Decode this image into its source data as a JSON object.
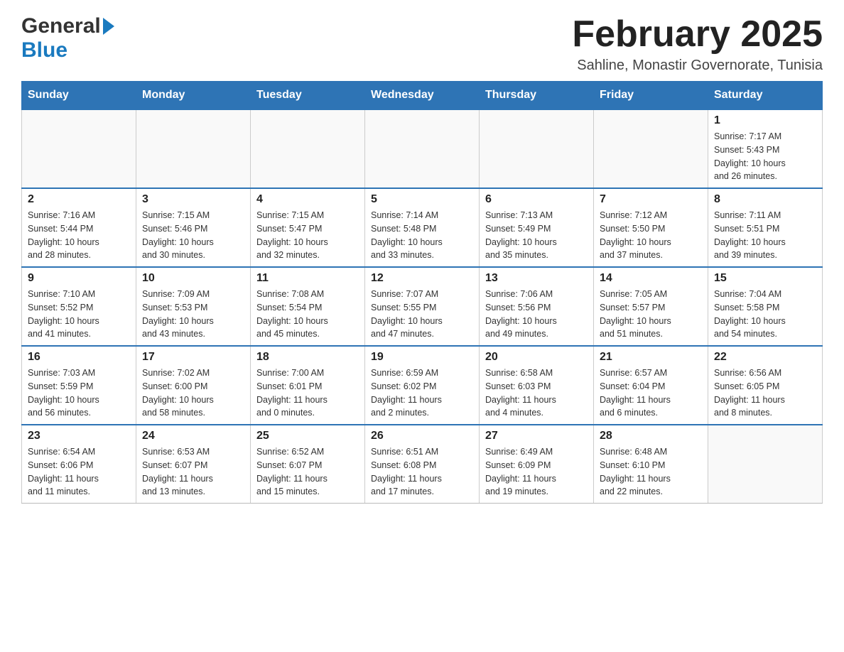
{
  "header": {
    "logo_general": "General",
    "logo_blue": "Blue",
    "main_title": "February 2025",
    "subtitle": "Sahline, Monastir Governorate, Tunisia"
  },
  "calendar": {
    "days_of_week": [
      "Sunday",
      "Monday",
      "Tuesday",
      "Wednesday",
      "Thursday",
      "Friday",
      "Saturday"
    ],
    "weeks": [
      [
        {
          "day": "",
          "info": ""
        },
        {
          "day": "",
          "info": ""
        },
        {
          "day": "",
          "info": ""
        },
        {
          "day": "",
          "info": ""
        },
        {
          "day": "",
          "info": ""
        },
        {
          "day": "",
          "info": ""
        },
        {
          "day": "1",
          "info": "Sunrise: 7:17 AM\nSunset: 5:43 PM\nDaylight: 10 hours\nand 26 minutes."
        }
      ],
      [
        {
          "day": "2",
          "info": "Sunrise: 7:16 AM\nSunset: 5:44 PM\nDaylight: 10 hours\nand 28 minutes."
        },
        {
          "day": "3",
          "info": "Sunrise: 7:15 AM\nSunset: 5:46 PM\nDaylight: 10 hours\nand 30 minutes."
        },
        {
          "day": "4",
          "info": "Sunrise: 7:15 AM\nSunset: 5:47 PM\nDaylight: 10 hours\nand 32 minutes."
        },
        {
          "day": "5",
          "info": "Sunrise: 7:14 AM\nSunset: 5:48 PM\nDaylight: 10 hours\nand 33 minutes."
        },
        {
          "day": "6",
          "info": "Sunrise: 7:13 AM\nSunset: 5:49 PM\nDaylight: 10 hours\nand 35 minutes."
        },
        {
          "day": "7",
          "info": "Sunrise: 7:12 AM\nSunset: 5:50 PM\nDaylight: 10 hours\nand 37 minutes."
        },
        {
          "day": "8",
          "info": "Sunrise: 7:11 AM\nSunset: 5:51 PM\nDaylight: 10 hours\nand 39 minutes."
        }
      ],
      [
        {
          "day": "9",
          "info": "Sunrise: 7:10 AM\nSunset: 5:52 PM\nDaylight: 10 hours\nand 41 minutes."
        },
        {
          "day": "10",
          "info": "Sunrise: 7:09 AM\nSunset: 5:53 PM\nDaylight: 10 hours\nand 43 minutes."
        },
        {
          "day": "11",
          "info": "Sunrise: 7:08 AM\nSunset: 5:54 PM\nDaylight: 10 hours\nand 45 minutes."
        },
        {
          "day": "12",
          "info": "Sunrise: 7:07 AM\nSunset: 5:55 PM\nDaylight: 10 hours\nand 47 minutes."
        },
        {
          "day": "13",
          "info": "Sunrise: 7:06 AM\nSunset: 5:56 PM\nDaylight: 10 hours\nand 49 minutes."
        },
        {
          "day": "14",
          "info": "Sunrise: 7:05 AM\nSunset: 5:57 PM\nDaylight: 10 hours\nand 51 minutes."
        },
        {
          "day": "15",
          "info": "Sunrise: 7:04 AM\nSunset: 5:58 PM\nDaylight: 10 hours\nand 54 minutes."
        }
      ],
      [
        {
          "day": "16",
          "info": "Sunrise: 7:03 AM\nSunset: 5:59 PM\nDaylight: 10 hours\nand 56 minutes."
        },
        {
          "day": "17",
          "info": "Sunrise: 7:02 AM\nSunset: 6:00 PM\nDaylight: 10 hours\nand 58 minutes."
        },
        {
          "day": "18",
          "info": "Sunrise: 7:00 AM\nSunset: 6:01 PM\nDaylight: 11 hours\nand 0 minutes."
        },
        {
          "day": "19",
          "info": "Sunrise: 6:59 AM\nSunset: 6:02 PM\nDaylight: 11 hours\nand 2 minutes."
        },
        {
          "day": "20",
          "info": "Sunrise: 6:58 AM\nSunset: 6:03 PM\nDaylight: 11 hours\nand 4 minutes."
        },
        {
          "day": "21",
          "info": "Sunrise: 6:57 AM\nSunset: 6:04 PM\nDaylight: 11 hours\nand 6 minutes."
        },
        {
          "day": "22",
          "info": "Sunrise: 6:56 AM\nSunset: 6:05 PM\nDaylight: 11 hours\nand 8 minutes."
        }
      ],
      [
        {
          "day": "23",
          "info": "Sunrise: 6:54 AM\nSunset: 6:06 PM\nDaylight: 11 hours\nand 11 minutes."
        },
        {
          "day": "24",
          "info": "Sunrise: 6:53 AM\nSunset: 6:07 PM\nDaylight: 11 hours\nand 13 minutes."
        },
        {
          "day": "25",
          "info": "Sunrise: 6:52 AM\nSunset: 6:07 PM\nDaylight: 11 hours\nand 15 minutes."
        },
        {
          "day": "26",
          "info": "Sunrise: 6:51 AM\nSunset: 6:08 PM\nDaylight: 11 hours\nand 17 minutes."
        },
        {
          "day": "27",
          "info": "Sunrise: 6:49 AM\nSunset: 6:09 PM\nDaylight: 11 hours\nand 19 minutes."
        },
        {
          "day": "28",
          "info": "Sunrise: 6:48 AM\nSunset: 6:10 PM\nDaylight: 11 hours\nand 22 minutes."
        },
        {
          "day": "",
          "info": ""
        }
      ]
    ]
  }
}
